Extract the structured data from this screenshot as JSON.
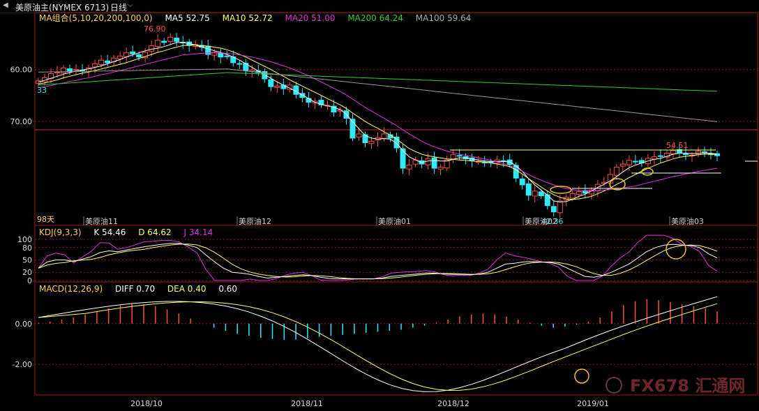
{
  "header": {
    "instrument": "美原油主(NYMEX 6713)",
    "period": "日线"
  },
  "colors": {
    "up": "#ff4d4d",
    "down": "#30e8f8",
    "ma5": "#ffffff",
    "ma10": "#ffff66",
    "ma20": "#dd33dd",
    "ma200": "#33cc33",
    "ma100": "#999999",
    "grid": "#8a1c1c",
    "frame": "#a01818",
    "highlight": "#f0c030"
  },
  "price_panel": {
    "legend_title": "MA组合(5,10,20,200,100,0)",
    "ma5": "MA5 52.75",
    "ma10": "MA10 52.72",
    "ma20": "MA20 51.00",
    "ma200": "MA200 64.24",
    "ma100": "MA100 59.64",
    "y_ticks": [
      "70.00",
      "60.00"
    ],
    "high_label": "76.90",
    "low_label": "42.36",
    "recent_high_label": "54.51",
    "left_edge_label": "33",
    "days_label": "98天",
    "contract_labels": [
      "美原油11",
      "美原油12",
      "美原油01",
      "美原油02",
      "美原油03"
    ]
  },
  "kdj_panel": {
    "legend_title": "KDJ(9,3,3)",
    "k": "K 54.46",
    "d": "D 64.62",
    "j": "J 34.14",
    "y_ticks": [
      "100",
      "80",
      "50",
      "20",
      "0"
    ]
  },
  "macd_panel": {
    "legend_title": "MACD(12,26,9)",
    "diff": "DIFF 0.70",
    "dea": "DEA 0.40",
    "macd": "0.60",
    "y_ticks": [
      "0.00",
      "-2.00"
    ]
  },
  "x_axis": {
    "labels": [
      "2018/10",
      "2018/11",
      "2018/12",
      "2019/01"
    ]
  },
  "watermark": "FX678 汇通网",
  "chart_data": [
    {
      "type": "candlestick",
      "title": "美原油主(NYMEX 6713) 日线",
      "ylim": [
        40,
        78
      ],
      "yticks": [
        60,
        70
      ],
      "series": [
        {
          "name": "MA5",
          "last": 52.75
        },
        {
          "name": "MA10",
          "last": 52.72
        },
        {
          "name": "MA20",
          "last": 51.0
        },
        {
          "name": "MA200",
          "last": 64.24
        },
        {
          "name": "MA100",
          "last": 59.64
        }
      ],
      "annotations": {
        "high": 76.9,
        "low": 42.36,
        "recent_high": 54.51
      },
      "close": [
        67.8,
        68.4,
        69.2,
        69.5,
        70.3,
        69.6,
        70.0,
        69.8,
        70.3,
        71.1,
        71.8,
        71.3,
        72.2,
        72.6,
        73.2,
        73.0,
        72.4,
        73.3,
        74.6,
        75.6,
        75.2,
        76.2,
        75.4,
        75.1,
        74.6,
        74.8,
        74.3,
        72.9,
        73.3,
        72.4,
        72.6,
        71.3,
        71.0,
        69.8,
        69.9,
        69.4,
        68.2,
        66.7,
        66.8,
        66.3,
        67.0,
        65.2,
        64.6,
        63.7,
        63.9,
        63.2,
        63.1,
        61.8,
        62.2,
        60.6,
        56.8,
        57.6,
        55.9,
        56.2,
        56.9,
        57.6,
        56.8,
        54.9,
        51.0,
        51.6,
        52.6,
        51.8,
        52.8,
        51.0,
        51.2,
        52.6,
        53.6,
        53.4,
        52.8,
        52.4,
        52.3,
        52.0,
        52.1,
        52.6,
        52.4,
        51.7,
        49.1,
        47.8,
        45.8,
        46.6,
        45.7,
        43.8,
        42.6,
        44.7,
        45.4,
        46.1,
        46.5,
        46.2,
        46.8,
        47.9,
        48.3,
        49.8,
        51.2,
        51.8,
        52.5,
        52.3,
        52.0,
        52.9,
        53.2,
        53.3,
        53.9,
        54.4,
        53.9,
        53.6,
        53.5,
        54.3,
        53.9,
        53.6,
        53.4
      ],
      "ma5": [
        67.6,
        67.9,
        68.3,
        68.7,
        69.1,
        69.4,
        69.7,
        69.9,
        70.1,
        70.4,
        70.7,
        71.1,
        71.5,
        71.9,
        72.4,
        72.8,
        73.2,
        73.6,
        73.9,
        74.1,
        74.4,
        74.8,
        75.2,
        75.2,
        75.0,
        74.7,
        74.3,
        74.0,
        73.6,
        73.3,
        72.9,
        72.4,
        71.8,
        71.1,
        70.4,
        69.7,
        69.0,
        68.3,
        67.6,
        67.0,
        66.4,
        65.8,
        65.1,
        64.4,
        63.7,
        63.3,
        63.0,
        62.7,
        62.3,
        61.4,
        59.9,
        58.6,
        57.3,
        56.8,
        56.6,
        56.7,
        56.6,
        55.8,
        54.4,
        53.2,
        52.6,
        52.1,
        52.4,
        52.5,
        52.4,
        52.4,
        52.7,
        53.0,
        53.0,
        52.8,
        52.6,
        52.4,
        52.3,
        52.3,
        52.3,
        52.2,
        51.5,
        50.4,
        49.0,
        47.8,
        46.8,
        45.8,
        44.7,
        44.5,
        44.6,
        45.0,
        45.6,
        46.0,
        46.6,
        47.3,
        47.9,
        48.6,
        49.4,
        50.3,
        51.1,
        51.6,
        52.0,
        52.4,
        52.7,
        52.9,
        53.3,
        53.7,
        53.9,
        53.9,
        53.8,
        53.9,
        53.9,
        53.9,
        53.7
      ],
      "ma10": [
        67.2,
        67.4,
        67.7,
        68.0,
        68.4,
        68.7,
        69.0,
        69.3,
        69.5,
        69.8,
        70.1,
        70.4,
        70.7,
        71.0,
        71.3,
        71.7,
        72.1,
        72.5,
        72.9,
        73.3,
        73.6,
        74.0,
        74.3,
        74.6,
        74.7,
        74.7,
        74.6,
        74.5,
        74.3,
        74.1,
        73.8,
        73.4,
        72.9,
        72.4,
        71.8,
        71.2,
        70.6,
        70.0,
        69.3,
        68.7,
        68.0,
        67.4,
        66.8,
        66.2,
        65.6,
        65.0,
        64.4,
        63.8,
        63.2,
        62.5,
        61.6,
        60.8,
        60.0,
        59.3,
        58.7,
        58.0,
        57.4,
        56.6,
        55.7,
        54.8,
        54.2,
        53.7,
        53.4,
        53.2,
        53.0,
        52.8,
        52.7,
        52.6,
        52.5,
        52.4,
        52.3,
        52.2,
        52.0,
        51.8,
        51.6,
        51.3,
        50.7,
        49.9,
        49.0,
        48.2,
        47.4,
        46.6,
        45.9,
        45.4,
        45.1,
        45.0,
        45.1,
        45.3,
        45.6,
        46.1,
        46.6,
        47.2,
        47.9,
        48.5,
        49.2,
        49.8,
        50.4,
        51.0,
        51.5,
        52.0,
        52.4,
        52.8,
        53.1,
        53.3,
        53.4,
        53.6,
        53.7,
        53.7,
        53.7
      ],
      "ma20": [
        66.5,
        66.7,
        66.9,
        67.2,
        67.4,
        67.7,
        67.9,
        68.2,
        68.4,
        68.7,
        69.0,
        69.2,
        69.5,
        69.8,
        70.1,
        70.4,
        70.7,
        71.0,
        71.3,
        71.6,
        71.9,
        72.2,
        72.5,
        72.8,
        72.9,
        73.0,
        73.1,
        73.2,
        73.2,
        73.2,
        73.1,
        73.0,
        72.8,
        72.6,
        72.4,
        72.1,
        71.8,
        71.5,
        71.1,
        70.7,
        70.3,
        69.8,
        69.3,
        68.8,
        68.2,
        67.6,
        67.0,
        66.4,
        65.8,
        65.1,
        64.3,
        63.5,
        62.7,
        62.0,
        61.3,
        60.6,
        59.9,
        59.2,
        58.4,
        57.6,
        56.9,
        56.2,
        55.6,
        55.1,
        54.7,
        54.3,
        54.0,
        53.7,
        53.5,
        53.3,
        53.0,
        52.8,
        52.5,
        52.2,
        51.9,
        51.5,
        51.0,
        50.4,
        49.8,
        49.2,
        48.7,
        48.2,
        47.8,
        47.4,
        47.1,
        46.9,
        46.7,
        46.6,
        46.6,
        46.7,
        46.8,
        46.9,
        47.0,
        47.2,
        47.4,
        47.6,
        47.9,
        48.2,
        48.5,
        48.8,
        49.1,
        49.4,
        49.6,
        49.9,
        50.1,
        50.4,
        50.6,
        50.8,
        51.0
      ]
    },
    {
      "type": "line",
      "title": "KDJ(9,3,3)",
      "ylim": [
        0,
        100
      ],
      "yticks": [
        0,
        20,
        50,
        80,
        100
      ],
      "series": [
        {
          "name": "K",
          "last": 54.46
        },
        {
          "name": "D",
          "last": 64.62
        },
        {
          "name": "J",
          "last": 34.14
        }
      ],
      "k": [
        30,
        45,
        50,
        50,
        46,
        52,
        58,
        68,
        72,
        70,
        74,
        78,
        82,
        85,
        88,
        90,
        90,
        86,
        80,
        62,
        45,
        30,
        20,
        18,
        15,
        10,
        6,
        8,
        10,
        12,
        14,
        12,
        8,
        5,
        4,
        4,
        4,
        4,
        4,
        6,
        10,
        12,
        14,
        16,
        18,
        18,
        16,
        15,
        15,
        14,
        16,
        20,
        30,
        40,
        42,
        45,
        46,
        45,
        44,
        40,
        30,
        20,
        10,
        8,
        12,
        20,
        30,
        40,
        55,
        70,
        80,
        86,
        88,
        86,
        85,
        80,
        65,
        55
      ]
    },
    {
      "type": "bar",
      "title": "MACD(12,26,9)",
      "ylim": [
        -3.5,
        1.5
      ],
      "yticks": [
        0,
        -2
      ],
      "series": [
        {
          "name": "DIFF",
          "last": 0.7
        },
        {
          "name": "DEA",
          "last": 0.4
        },
        {
          "name": "MACD",
          "last": 0.6
        }
      ],
      "hist": [
        0.05,
        0.1,
        0.2,
        0.3,
        0.45,
        0.6,
        0.75,
        0.9,
        1.0,
        0.95,
        0.85,
        0.7,
        0.5,
        0.25,
        0.0,
        -0.2,
        -0.35,
        -0.5,
        -0.6,
        -0.7,
        -0.75,
        -0.8,
        -0.78,
        -0.72,
        -0.65,
        -0.6,
        -0.55,
        -0.5,
        -0.45,
        -0.4,
        -0.35,
        -0.3,
        -0.2,
        -0.1,
        0.05,
        0.2,
        0.35,
        0.45,
        0.5,
        0.45,
        0.35,
        0.2,
        0.05,
        -0.1,
        -0.2,
        -0.15,
        -0.05,
        0.1,
        0.3,
        0.6,
        0.9,
        1.1,
        1.2,
        1.15,
        1.05,
        0.95,
        0.85,
        0.75,
        0.6
      ]
    }
  ]
}
